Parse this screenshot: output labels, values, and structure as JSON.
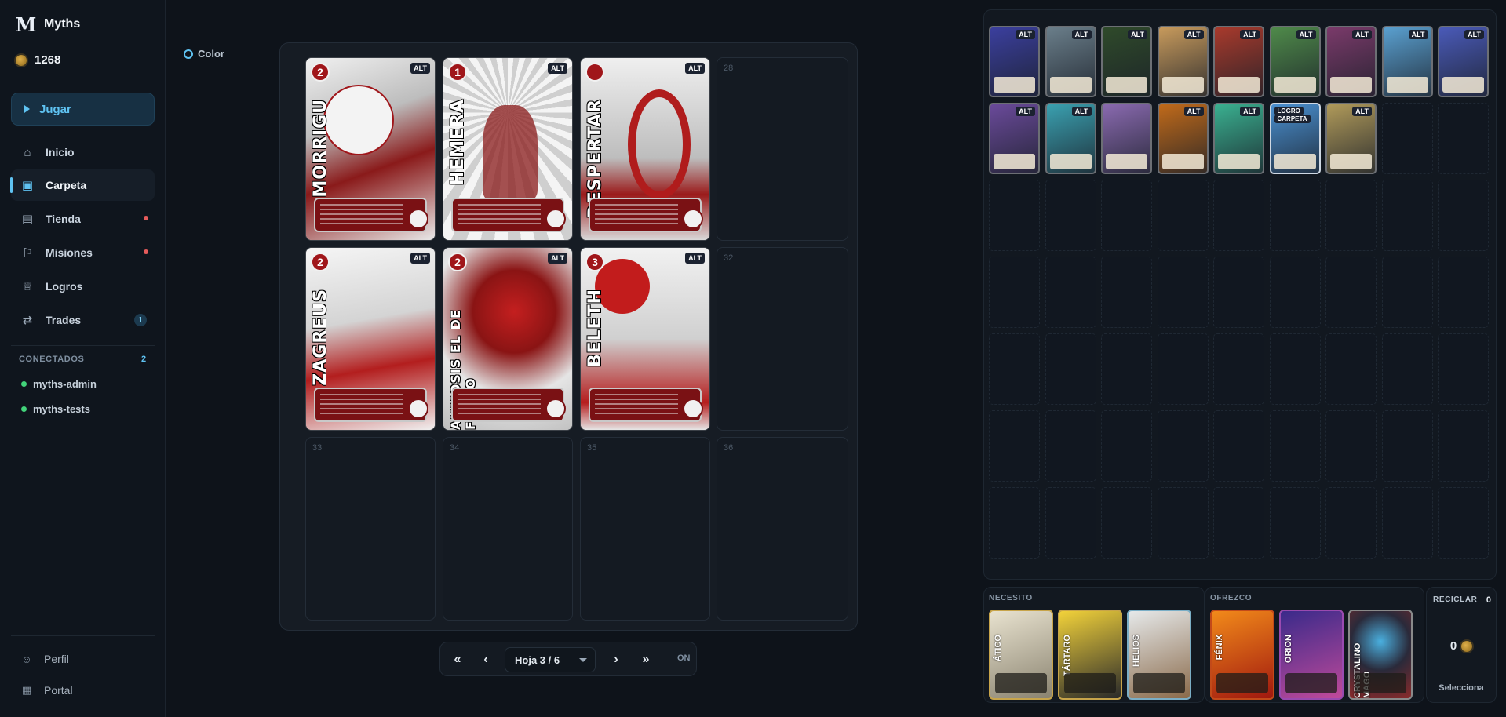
{
  "app": {
    "name": "Myths",
    "coins": "1268"
  },
  "nav": {
    "play": "Jugar",
    "items": [
      {
        "label": "Inicio",
        "icon": "home-icon"
      },
      {
        "label": "Carpeta",
        "icon": "binder-icon",
        "active": true
      },
      {
        "label": "Tienda",
        "icon": "store-icon",
        "dot": true
      },
      {
        "label": "Misiones",
        "icon": "flag-icon",
        "dot": true
      },
      {
        "label": "Logros",
        "icon": "trophy-icon"
      },
      {
        "label": "Trades",
        "icon": "swap-icon",
        "count": "1"
      }
    ]
  },
  "connected": {
    "title": "CONECTADOS",
    "count": "2",
    "users": [
      "myths-admin",
      "myths-tests"
    ]
  },
  "footer": {
    "profile": "Perfil",
    "portal": "Portal"
  },
  "toolbar": {
    "color_label": "Color"
  },
  "binder": {
    "cards": [
      {
        "name": "MORRIGU",
        "cost": "2",
        "alt": "ALT"
      },
      {
        "name": "HEMERA",
        "cost": "1",
        "alt": "ALT"
      },
      {
        "name": "DESPERTAR",
        "cost": "",
        "alt": "ALT"
      },
      {
        "name": "ZAGREUS",
        "cost": "2",
        "alt": "ALT"
      },
      {
        "name": "AHMOSIS EL DE FUEGO",
        "cost": "2",
        "alt": "ALT"
      },
      {
        "name": "BELETH",
        "cost": "3",
        "alt": "ALT"
      }
    ],
    "empty_slots": [
      "28",
      "32",
      "33",
      "34",
      "35",
      "36"
    ]
  },
  "pager": {
    "first": "«",
    "prev": "‹",
    "page": "Hoja 3 / 6",
    "next": "›",
    "last": "»",
    "toggle": "ON"
  },
  "collection": {
    "alt_label": "ALT",
    "achievement_label": "LOGRO",
    "binder_label": "CARPETA",
    "colors": [
      "#3b3f9e",
      "#6a7e8a",
      "#2f4a2a",
      "#c79a5c",
      "#a83a2c",
      "#4f8a4a",
      "#7a3a6a",
      "#5aa0d0",
      "#4a5ab8",
      "#6a4a9a",
      "#3aa0b0",
      "#8a6ab0",
      "#c06a1a",
      "#3ab090",
      "#4a90d0",
      "#b09a5a"
    ]
  },
  "trade": {
    "need_title": "NECESITO",
    "need": [
      {
        "name": "ÁTICO"
      },
      {
        "name": "TÁRTARO"
      },
      {
        "name": "HELIOS"
      }
    ],
    "offer_title": "OFREZCO",
    "offer": [
      {
        "name": "FÉNIX"
      },
      {
        "name": "ORION"
      },
      {
        "name": "CRYSTALINO MAGO"
      }
    ]
  },
  "recycle": {
    "title": "RECICLAR",
    "count": "0",
    "amount": "0",
    "select": "Selecciona"
  }
}
